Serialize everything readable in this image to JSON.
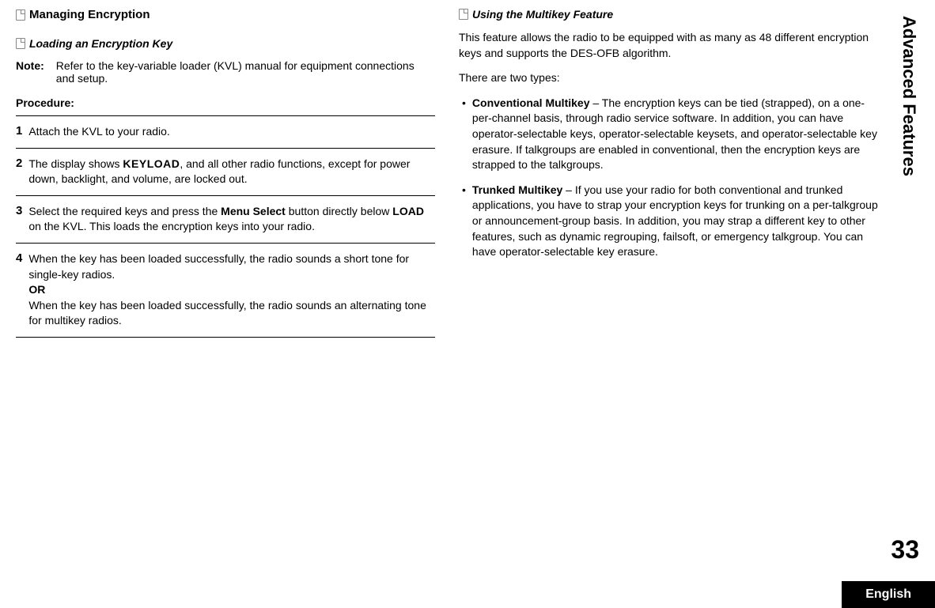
{
  "sidebar": {
    "title": "Advanced Features"
  },
  "pageNumber": "33",
  "footer": {
    "language": "English"
  },
  "leftColumn": {
    "heading": "Managing Encryption",
    "subheading": "Loading an Encryption Key",
    "noteLabel": "Note:",
    "noteText": "Refer to the key-variable loader (KVL) manual for equipment connections and setup.",
    "procedureLabel": "Procedure:",
    "steps": [
      {
        "num": "1",
        "text": "Attach the KVL to your radio."
      },
      {
        "num": "2",
        "prefix": "The display shows ",
        "display": "KEYLOAD",
        "suffix": ", and all other radio functions, except for power down, backlight, and volume, are locked out."
      },
      {
        "num": "3",
        "prefix": "Select the required keys and press the ",
        "bold1": "Menu Select",
        "mid": " button directly below ",
        "bold2": "LOAD",
        "suffix": " on the KVL. This loads the encryption keys into your radio."
      },
      {
        "num": "4",
        "line1": "When the key has been loaded successfully, the radio sounds a short tone for single-key radios.",
        "or": "OR",
        "line2": "When the key has been loaded successfully, the radio sounds an alternating tone for multikey radios."
      }
    ]
  },
  "rightColumn": {
    "subheading": "Using the Multikey Feature",
    "para1": "This feature allows the radio to be equipped with as many as 48 different encryption keys and supports the DES-OFB algorithm.",
    "para2": "There are two types:",
    "bullets": [
      {
        "boldLabel": "Conventional Multikey",
        "text": " – The encryption keys can be tied (strapped), on a one-per-channel basis, through radio service software. In addition, you can have operator-selectable keys, operator-selectable keysets, and operator-selectable key erasure. If talkgroups are enabled in conventional, then the encryption keys are strapped to the talkgroups."
      },
      {
        "boldLabel": "Trunked Multikey",
        "text": " – If you use your radio for both conventional and trunked applications, you have to strap your encryption keys for trunking on a per-talkgroup or announcement-group basis. In addition, you may strap a different key to other features, such as dynamic regrouping, failsoft, or emergency talkgroup. You can have operator-selectable key erasure."
      }
    ]
  }
}
